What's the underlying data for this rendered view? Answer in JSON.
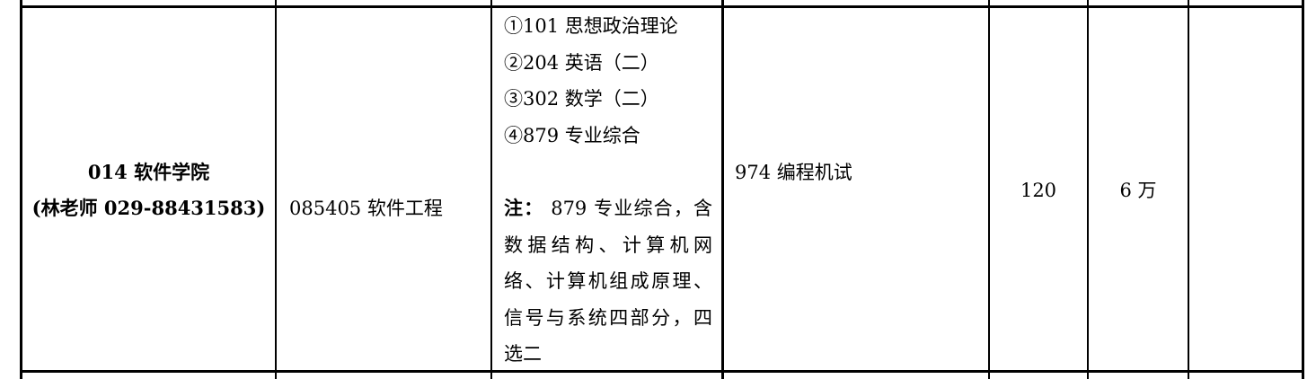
{
  "row": {
    "department": {
      "name": "014 软件学院",
      "contact": "(林老师  029-88431583)"
    },
    "major": "085405 软件工程",
    "exam_subjects": [
      "①101 思想政治理论",
      "②204 英语（二）",
      "③302 数学（二）",
      "④879 专业综合"
    ],
    "note": {
      "label": "注：",
      "lines": [
        " 879 专业综合，含",
        "数据结构、计算机网",
        "络、计算机组成原理、",
        "信号与系统四部分，四",
        "选二"
      ]
    },
    "retest": "974  编程机试",
    "enrollment": "120",
    "tuition": "6 万",
    "remarks": ""
  }
}
